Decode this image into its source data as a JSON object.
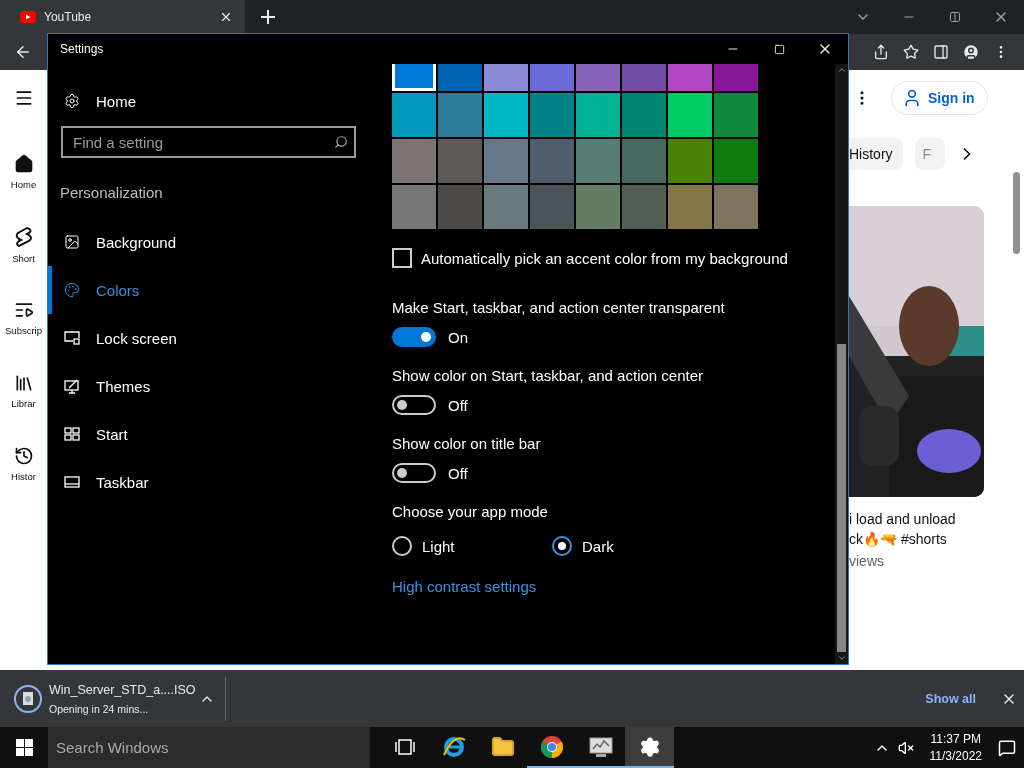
{
  "browser": {
    "tab": {
      "title": "YouTube"
    },
    "download": {
      "filename": "Win_Server_STD_a....ISO",
      "status": "Opening in 24 mins...",
      "show_all": "Show all"
    }
  },
  "youtube": {
    "rail": [
      {
        "kind": "home",
        "label": "Home"
      },
      {
        "kind": "shorts",
        "label": "Short"
      },
      {
        "kind": "subscriptions",
        "label": "Subscrip"
      },
      {
        "kind": "library",
        "label": "Librar"
      },
      {
        "kind": "history",
        "label": "Histor"
      }
    ],
    "sign_in": "Sign in",
    "chips": [
      {
        "label": "History",
        "selected": false
      },
      {
        "label": "F",
        "selected": false
      }
    ],
    "video": {
      "title_lines": [
        "i load and unload",
        "ck🔥🔫 #shorts"
      ],
      "views": "views"
    }
  },
  "settings": {
    "title": "Settings",
    "home": "Home",
    "search": {
      "placeholder": "Find a setting"
    },
    "section": "Personalization",
    "nav": [
      {
        "kind": "background",
        "label": "Background",
        "selected": false
      },
      {
        "kind": "colors",
        "label": "Colors",
        "selected": true
      },
      {
        "kind": "lock",
        "label": "Lock screen",
        "selected": false
      },
      {
        "kind": "themes",
        "label": "Themes",
        "selected": false
      },
      {
        "kind": "start",
        "label": "Start",
        "selected": false
      },
      {
        "kind": "taskbar",
        "label": "Taskbar",
        "selected": false
      }
    ],
    "swatches": [
      {
        "color": "#0078d7",
        "selected": true
      },
      {
        "color": "#0063b1",
        "selected": false
      },
      {
        "color": "#8e8cd8",
        "selected": false
      },
      {
        "color": "#6b69d6",
        "selected": false
      },
      {
        "color": "#8764b8",
        "selected": false
      },
      {
        "color": "#744da9",
        "selected": false
      },
      {
        "color": "#b146c2",
        "selected": false
      },
      {
        "color": "#881798",
        "selected": false
      },
      {
        "color": "#0099bc",
        "selected": false
      },
      {
        "color": "#2d7d9a",
        "selected": false
      },
      {
        "color": "#00b7c3",
        "selected": false
      },
      {
        "color": "#038387",
        "selected": false
      },
      {
        "color": "#00b294",
        "selected": false
      },
      {
        "color": "#018574",
        "selected": false
      },
      {
        "color": "#00cc6a",
        "selected": false
      },
      {
        "color": "#10893e",
        "selected": false
      },
      {
        "color": "#7a7574",
        "selected": false
      },
      {
        "color": "#5d5a58",
        "selected": false
      },
      {
        "color": "#68768a",
        "selected": false
      },
      {
        "color": "#515c6b",
        "selected": false
      },
      {
        "color": "#567c73",
        "selected": false
      },
      {
        "color": "#486860",
        "selected": false
      },
      {
        "color": "#498205",
        "selected": false
      },
      {
        "color": "#107c10",
        "selected": false
      },
      {
        "color": "#767676",
        "selected": false
      },
      {
        "color": "#4c4a48",
        "selected": false
      },
      {
        "color": "#69797e",
        "selected": false
      },
      {
        "color": "#4a5459",
        "selected": false
      },
      {
        "color": "#647c64",
        "selected": false
      },
      {
        "color": "#525e54",
        "selected": false
      },
      {
        "color": "#847545",
        "selected": false
      },
      {
        "color": "#7e735f",
        "selected": false
      }
    ],
    "auto_accent": {
      "label": "Automatically pick an accent color from my background",
      "checked": false
    },
    "toggles": [
      {
        "label": "Make Start, taskbar, and action center transparent",
        "on": true,
        "state_text": "On"
      },
      {
        "label": "Show color on Start, taskbar, and action center",
        "on": false,
        "state_text": "Off"
      },
      {
        "label": "Show color on title bar",
        "on": false,
        "state_text": "Off"
      }
    ],
    "app_mode": {
      "label": "Choose your app mode",
      "options": [
        {
          "label": "Light",
          "selected": false
        },
        {
          "label": "Dark",
          "selected": true
        }
      ]
    },
    "link": "High contrast settings"
  },
  "taskbar": {
    "search": {
      "placeholder": "Search Windows"
    },
    "apps": [
      {
        "kind": "taskview",
        "running": false,
        "selected": false
      },
      {
        "kind": "ie",
        "running": false,
        "selected": false
      },
      {
        "kind": "explorer",
        "running": false,
        "selected": false
      },
      {
        "kind": "chrome",
        "running": true,
        "selected": false
      },
      {
        "kind": "monitor",
        "running": true,
        "selected": false
      },
      {
        "kind": "settings",
        "running": true,
        "selected": true
      }
    ],
    "time": "11:37 PM",
    "date": "11/3/2022"
  }
}
